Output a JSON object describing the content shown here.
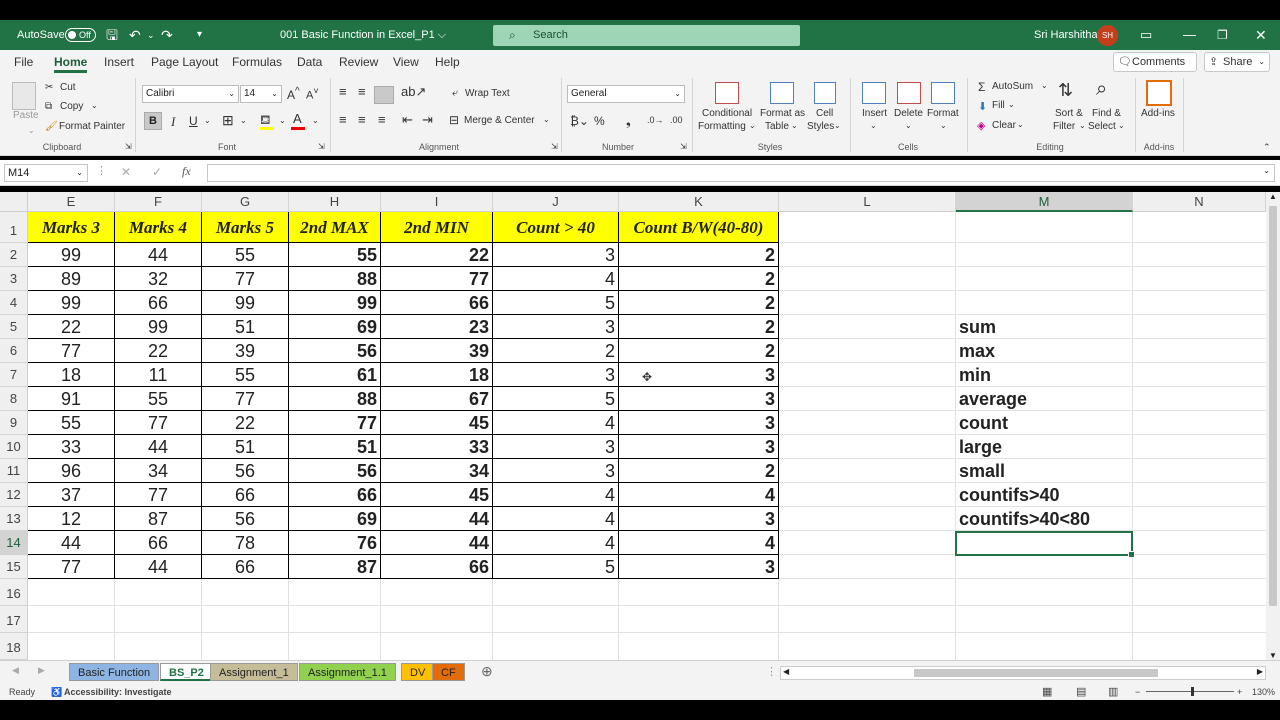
{
  "titlebar": {
    "autosave_label": "AutoSave",
    "autosave_state": "Off",
    "file_name": "001 Basic Function in Excel_P1 ⌵",
    "search_placeholder": "Search",
    "user_name": "Sri Harshitha",
    "user_initials": "SH"
  },
  "menu": {
    "tabs": [
      "File",
      "Home",
      "Insert",
      "Page Layout",
      "Formulas",
      "Data",
      "Review",
      "View",
      "Help"
    ],
    "comments": "Comments",
    "share": "Share"
  },
  "ribbon": {
    "paste": "Paste",
    "cut": "Cut",
    "copy": "Copy",
    "format_painter": "Format Painter",
    "clipboard": "Clipboard",
    "font_name": "Calibri",
    "font_size": "14",
    "font": "Font",
    "bold": "B",
    "italic": "I",
    "underline": "U",
    "wrap_text": "Wrap Text",
    "merge_center": "Merge & Center",
    "alignment": "Alignment",
    "number_format": "General",
    "number": "Number",
    "conditional": "Conditional",
    "formatting": "Formatting",
    "format_as": "Format as",
    "table": "Table",
    "cell": "Cell",
    "styles_btn": "Styles",
    "styles": "Styles",
    "insert": "Insert",
    "delete": "Delete",
    "format": "Format",
    "cells": "Cells",
    "autosum": "AutoSum",
    "fill": "Fill",
    "clear": "Clear",
    "sort": "Sort &",
    "filter": "Filter",
    "find": "Find &",
    "select": "Select",
    "editing": "Editing",
    "addins": "Add-ins"
  },
  "formula_bar": {
    "name_box": "M14",
    "fx": "fx",
    "value": ""
  },
  "columns": [
    "E",
    "F",
    "G",
    "H",
    "I",
    "J",
    "K",
    "L",
    "M",
    "N"
  ],
  "row_numbers": [
    "1",
    "2",
    "3",
    "4",
    "5",
    "6",
    "7",
    "8",
    "9",
    "10",
    "11",
    "12",
    "13",
    "14",
    "15",
    "16",
    "17",
    "18"
  ],
  "table": {
    "headers": [
      "Marks 3",
      "Marks 4",
      "Marks 5",
      "2nd MAX",
      "2nd MIN",
      "Count > 40",
      "Count B/W(40-80)"
    ],
    "rows": [
      [
        "99",
        "44",
        "55",
        "55",
        "22",
        "3",
        "2"
      ],
      [
        "89",
        "32",
        "77",
        "88",
        "77",
        "4",
        "2"
      ],
      [
        "99",
        "66",
        "99",
        "99",
        "66",
        "5",
        "2"
      ],
      [
        "22",
        "99",
        "51",
        "69",
        "23",
        "3",
        "2"
      ],
      [
        "77",
        "22",
        "39",
        "56",
        "39",
        "2",
        "2"
      ],
      [
        "18",
        "11",
        "55",
        "61",
        "18",
        "3",
        "3"
      ],
      [
        "91",
        "55",
        "77",
        "88",
        "67",
        "5",
        "3"
      ],
      [
        "55",
        "77",
        "22",
        "77",
        "45",
        "4",
        "3"
      ],
      [
        "33",
        "44",
        "51",
        "51",
        "33",
        "3",
        "3"
      ],
      [
        "96",
        "34",
        "56",
        "56",
        "34",
        "3",
        "2"
      ],
      [
        "37",
        "77",
        "66",
        "66",
        "45",
        "4",
        "4"
      ],
      [
        "12",
        "87",
        "56",
        "69",
        "44",
        "4",
        "3"
      ],
      [
        "44",
        "66",
        "78",
        "76",
        "44",
        "4",
        "4"
      ],
      [
        "77",
        "44",
        "66",
        "87",
        "66",
        "5",
        "3"
      ]
    ]
  },
  "m_labels": [
    "sum",
    "max",
    "min",
    "average",
    "count",
    "large",
    "small",
    "countifs>40",
    "countifs>40<80"
  ],
  "sheet_tabs": [
    {
      "label": "Basic Function",
      "color": "#8db4e2"
    },
    {
      "label": "BS_P2",
      "color": "#ffffff"
    },
    {
      "label": "Assignment_1",
      "color": "#c4bd97"
    },
    {
      "label": "Assignment_1.1",
      "color": "#92d050"
    },
    {
      "label": "DV",
      "color": "#ffc000"
    },
    {
      "label": "CF",
      "color": "#e26b0a"
    }
  ],
  "status": {
    "ready": "Ready",
    "accessibility": "Accessibility: Investigate",
    "zoom": "130%"
  }
}
